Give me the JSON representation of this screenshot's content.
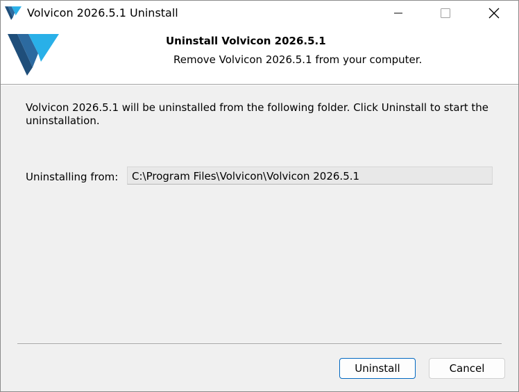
{
  "window": {
    "title": "Volvicon 2026.5.1 Uninstall"
  },
  "header": {
    "title": "Uninstall Volvicon 2026.5.1",
    "subtitle": "Remove Volvicon 2026.5.1 from your computer."
  },
  "body": {
    "description": "Volvicon 2026.5.1 will be uninstalled from the following folder. Click Uninstall to start the uninstallation.",
    "from_label": "Uninstalling from:",
    "path": "C:\\Program Files\\Volvicon\\Volvicon 2026.5.1"
  },
  "buttons": {
    "uninstall": "Uninstall",
    "cancel": "Cancel"
  },
  "icons": {
    "app": "volvicon-logo-icon",
    "minimize": "minimize-icon",
    "maximize": "maximize-icon",
    "close": "close-icon"
  },
  "colors": {
    "logo_dark": "#1f4e7a",
    "logo_light": "#29b0e8",
    "default_button_border": "#0067c0"
  }
}
